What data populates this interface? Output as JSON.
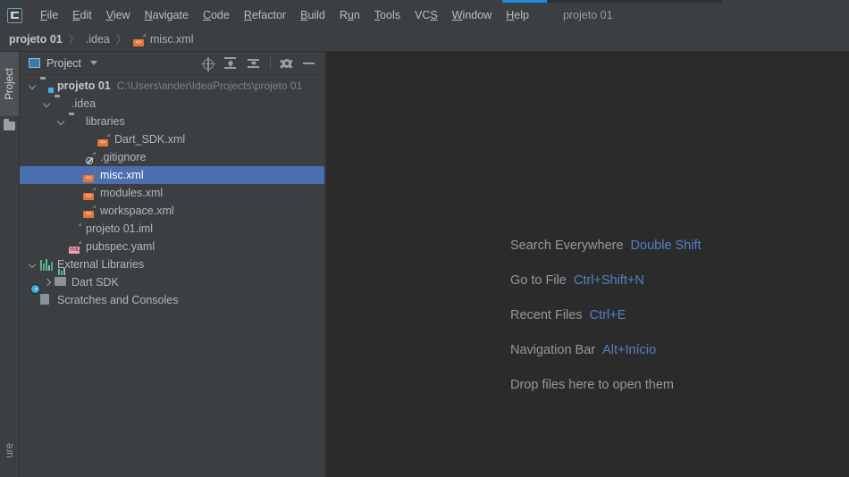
{
  "window": {
    "accent_blue": "#1a8cd8",
    "project_name": "projeto 01"
  },
  "menubar": {
    "items": [
      {
        "label": "File",
        "mnemonic": "F"
      },
      {
        "label": "Edit",
        "mnemonic": "E"
      },
      {
        "label": "View",
        "mnemonic": "V"
      },
      {
        "label": "Navigate",
        "mnemonic": "N"
      },
      {
        "label": "Code",
        "mnemonic": "C"
      },
      {
        "label": "Refactor",
        "mnemonic": "R"
      },
      {
        "label": "Build",
        "mnemonic": "B"
      },
      {
        "label": "Run",
        "mnemonic": "u"
      },
      {
        "label": "Tools",
        "mnemonic": "T"
      },
      {
        "label": "VCS",
        "mnemonic": "S"
      },
      {
        "label": "Window",
        "mnemonic": "W"
      },
      {
        "label": "Help",
        "mnemonic": "H"
      }
    ],
    "project_label": "projeto 01"
  },
  "breadcrumb": {
    "items": [
      "projeto 01",
      ".idea",
      "misc.xml"
    ],
    "separator": "〉"
  },
  "toolstrip": {
    "project_tab": "Project",
    "bottom_tab": "ure"
  },
  "panel": {
    "title": "Project",
    "tools": [
      {
        "name": "select-opened-file",
        "label": "Select Opened File"
      },
      {
        "name": "expand-all",
        "label": "Expand All"
      },
      {
        "name": "collapse-all",
        "label": "Collapse All"
      },
      {
        "name": "settings",
        "label": "Settings"
      },
      {
        "name": "hide",
        "label": "Hide"
      }
    ]
  },
  "tree": {
    "selected_color": "#4b6eaf",
    "rows": [
      {
        "label": "projeto 01",
        "path": "C:\\Users\\ander\\IdeaProjects\\projeto 01",
        "icon": "folder-module",
        "indent": 0,
        "chevron": "down",
        "bold": true,
        "selected": false
      },
      {
        "label": ".idea",
        "path": "",
        "icon": "folder",
        "indent": 1,
        "chevron": "down",
        "bold": false,
        "selected": false
      },
      {
        "label": "libraries",
        "path": "",
        "icon": "folder",
        "indent": 2,
        "chevron": "down",
        "bold": false,
        "selected": false
      },
      {
        "label": "Dart_SDK.xml",
        "path": "",
        "icon": "xml",
        "indent": 4,
        "chevron": "none",
        "bold": false,
        "selected": false
      },
      {
        "label": ".gitignore",
        "path": "",
        "icon": "gitignore",
        "indent": 3,
        "chevron": "none",
        "bold": false,
        "selected": false
      },
      {
        "label": "misc.xml",
        "path": "",
        "icon": "xml",
        "indent": 3,
        "chevron": "none",
        "bold": false,
        "selected": true
      },
      {
        "label": "modules.xml",
        "path": "",
        "icon": "xml",
        "indent": 3,
        "chevron": "none",
        "bold": false,
        "selected": false
      },
      {
        "label": "workspace.xml",
        "path": "",
        "icon": "xml",
        "indent": 3,
        "chevron": "none",
        "bold": false,
        "selected": false
      },
      {
        "label": "projeto 01.iml",
        "path": "",
        "icon": "iml",
        "indent": 2,
        "chevron": "none",
        "bold": false,
        "selected": false
      },
      {
        "label": "pubspec.yaml",
        "path": "",
        "icon": "yaml",
        "indent": 2,
        "chevron": "none",
        "bold": false,
        "selected": false
      },
      {
        "label": "External Libraries",
        "path": "",
        "icon": "libraries",
        "indent": 0,
        "chevron": "down",
        "bold": false,
        "selected": false
      },
      {
        "label": "Dart SDK",
        "path": "",
        "icon": "sdk",
        "indent": 1,
        "chevron": "right",
        "bold": false,
        "selected": false
      },
      {
        "label": "Scratches and Consoles",
        "path": "",
        "icon": "scratches",
        "indent": 0,
        "chevron": "none",
        "bold": false,
        "selected": false
      }
    ]
  },
  "editor": {
    "hints": [
      {
        "name": "Search Everywhere",
        "key": "Double Shift"
      },
      {
        "name": "Go to File",
        "key": "Ctrl+Shift+N"
      },
      {
        "name": "Recent Files",
        "key": "Ctrl+E"
      },
      {
        "name": "Navigation Bar",
        "key": "Alt+Início"
      },
      {
        "name": "Drop files here to open them",
        "key": ""
      }
    ],
    "hint_name_color": "#93999e",
    "hint_key_color": "#5680c2"
  }
}
